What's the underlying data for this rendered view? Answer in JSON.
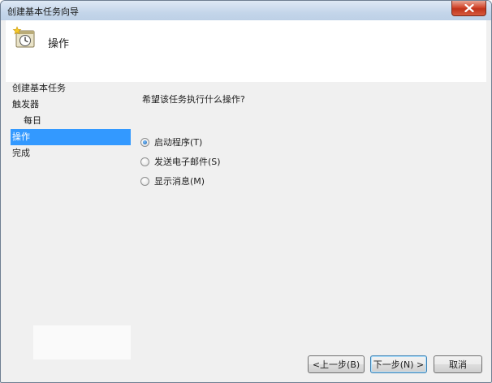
{
  "window": {
    "title": "创建基本任务向导"
  },
  "header": {
    "title": "操作",
    "icon": "task-scheduler-icon"
  },
  "nav": {
    "items": [
      {
        "label": "创建基本任务",
        "indent": false,
        "selected": false
      },
      {
        "label": "触发器",
        "indent": false,
        "selected": false
      },
      {
        "label": "每日",
        "indent": true,
        "selected": false
      },
      {
        "label": "操作",
        "indent": false,
        "selected": true
      },
      {
        "label": "完成",
        "indent": false,
        "selected": false
      }
    ]
  },
  "main": {
    "question": "希望该任务执行什么操作?",
    "options": [
      {
        "label": "启动程序(T)",
        "checked": true
      },
      {
        "label": "发送电子邮件(S)",
        "checked": false
      },
      {
        "label": "显示消息(M)",
        "checked": false
      }
    ]
  },
  "buttons": {
    "back": "<上一步(B)",
    "next": "下一步(N) >",
    "cancel": "取消"
  },
  "colors": {
    "selection": "#3399ff",
    "close_button": "#c0331a"
  }
}
